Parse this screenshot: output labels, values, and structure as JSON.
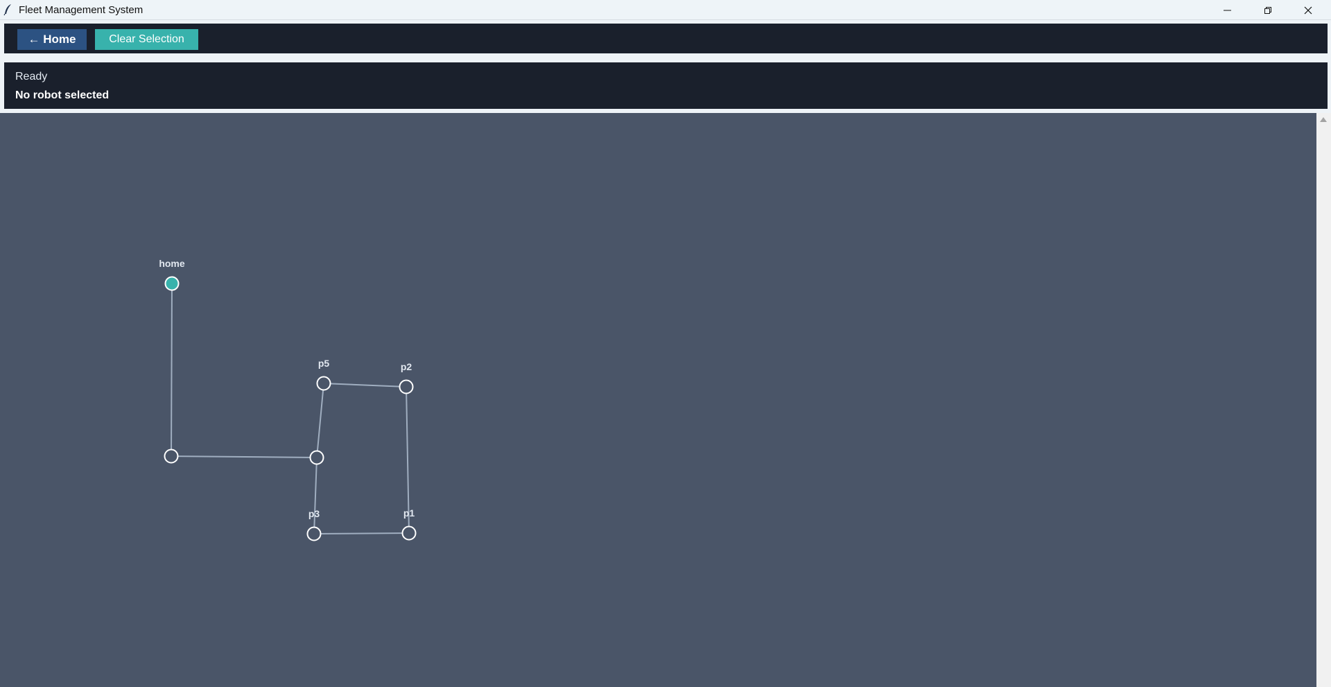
{
  "window": {
    "title": "Fleet Management System",
    "icon": "feather-icon",
    "controls": [
      "minimize-icon",
      "restore-icon",
      "close-icon"
    ]
  },
  "toolbar": {
    "home_label": "← Home",
    "clear_label": "Clear Selection"
  },
  "status": {
    "state": "Ready",
    "robot": "No robot selected"
  },
  "map": {
    "nodes": [
      {
        "label": "home",
        "active": true
      },
      {
        "label": "",
        "active": false
      },
      {
        "label": "",
        "active": false
      },
      {
        "label": "p5",
        "active": false
      },
      {
        "label": "p2",
        "active": false
      },
      {
        "label": "p3",
        "active": false
      },
      {
        "label": "p1",
        "active": false
      }
    ],
    "edges": [
      [
        "home",
        "node-2"
      ],
      [
        "node-2",
        "node-3"
      ],
      [
        "node-3",
        "p5"
      ],
      [
        "p5",
        "p2"
      ],
      [
        "p2",
        "p1"
      ],
      [
        "node-3",
        "p3"
      ],
      [
        "p3",
        "p1"
      ]
    ],
    "colors": {
      "background": "#4a5568",
      "edge": "#a0aec0",
      "node_stroke": "#ffffff",
      "active_fill": "#38b2ac"
    }
  }
}
